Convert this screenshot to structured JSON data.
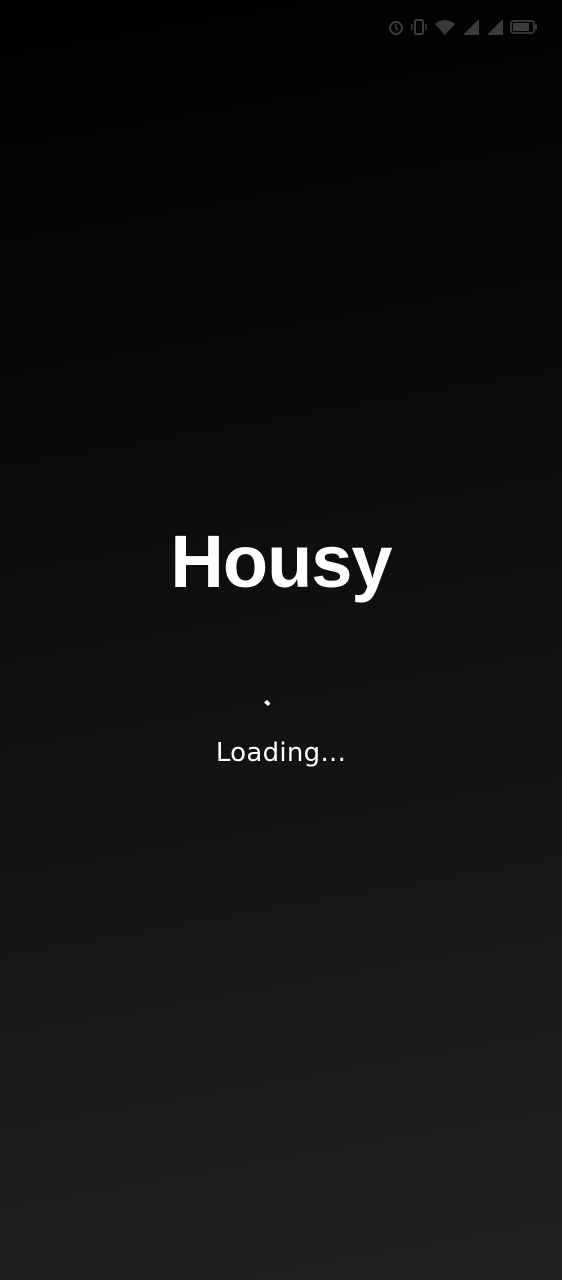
{
  "app": {
    "title": "Housy"
  },
  "status_bar": {
    "icons": [
      "alarm-icon",
      "vibrate-icon",
      "wifi-icon",
      "signal-icon",
      "signal-icon",
      "battery-icon"
    ]
  },
  "loading": {
    "label": "Loading..."
  },
  "colors": {
    "background_top": "#000000",
    "background_bottom": "#222222",
    "text": "#ffffff"
  }
}
